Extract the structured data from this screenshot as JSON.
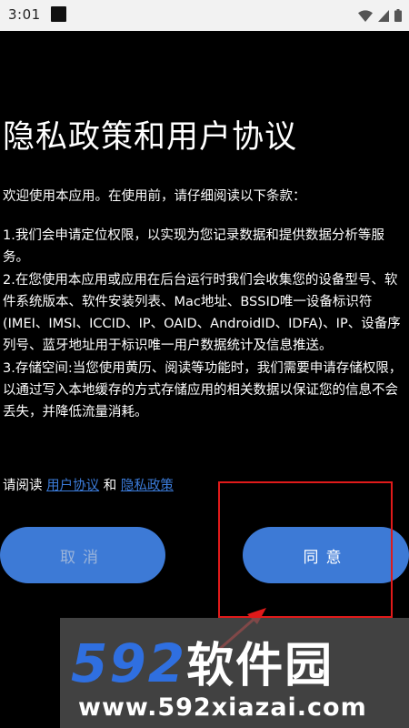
{
  "status_bar": {
    "time": "3:01",
    "icons": [
      "wifi-icon",
      "signal-icon",
      "battery-icon"
    ]
  },
  "dialog": {
    "title": "隐私政策和用户协议",
    "intro": "欢迎使用本应用。在使用前，请仔细阅读以下条款：",
    "terms": [
      "1.我们会申请定位权限，以实现为您记录数据和提供数据分析等服务。",
      "2.在您使用本应用或应用在后台运行时我们会收集您的设备型号、软件系统版本、软件安装列表、Mac地址、BSSID唯一设备标识符(IMEI、IMSI、ICCID、IP、OAID、AndroidID、IDFA)、IP、设备序列号、蓝牙地址用于标识唯一用户数据统计及信息推送。",
      "3.存储空间:当您使用黄历、阅读等功能时，我们需要申请存储权限，以通过写入本地缓存的方式存储应用的相关数据以保证您的信息不会丢失，并降低流量消耗。"
    ],
    "read_prefix": "请阅读",
    "user_agreement_link": "用户协议",
    "and_text": "和",
    "privacy_policy_link": "隐私政策",
    "cancel_label": "取消",
    "agree_label": "同意"
  },
  "colors": {
    "background": "#000000",
    "button": "#3d7ad6",
    "link": "#3b7bd9",
    "annotation": "#e01a1a"
  },
  "watermark": {
    "logo_number": "592",
    "logo_text": "软件园",
    "url": "www.592xiazai.com"
  }
}
